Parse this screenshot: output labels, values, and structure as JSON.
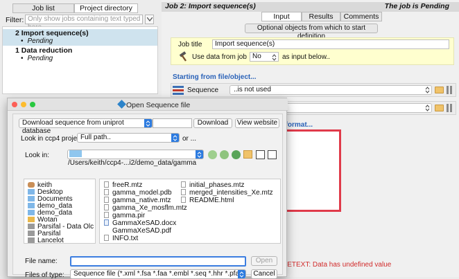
{
  "left": {
    "tabs": [
      "Job list",
      "Project directory"
    ],
    "filter_label": "Filter:",
    "filter_placeholder": "Only show jobs containing text typed here",
    "jobs": [
      {
        "title": "2 Import sequence(s)",
        "status": "Pending"
      },
      {
        "title": "1 Data reduction",
        "status": "Pending"
      }
    ]
  },
  "right": {
    "header_left": "Job 2:  Import sequence(s)",
    "header_right": "The job is Pending",
    "tabs": [
      "Input",
      "Results",
      "Comments"
    ],
    "optional_button": "Optional objects from which to start definition",
    "job_title_label": "Job title",
    "job_title_value": "Import sequence(s)",
    "use_data_label": "Use data from job",
    "use_data_value": "No",
    "as_input_label": "as input below..",
    "section_title": "Starting from file/object...",
    "sequence_label": "Sequence",
    "sequence_value": "..is not used",
    "format_title": "l format...",
    "error_text": "CETEXT: Data has undefined value"
  },
  "dialog": {
    "title": "Open Sequence file",
    "download_select": "Download sequence from uniprot database",
    "download_button": "Download",
    "website_button": "View website",
    "look_project_label": "Look in ccp4 project:",
    "look_project_value": "Full path..",
    "or_label": "or ...",
    "look_in_label": "Look in:",
    "look_in_path": "/Users/keith/ccp4-...i2/demo_data/gamma",
    "places": [
      "keith",
      "Desktop",
      "Documents",
      "demo_data",
      "demo_data",
      "Wotan",
      "Parsifal - Data Olc",
      "Parsifal",
      "Lancelot"
    ],
    "files_col1": [
      "freeR.mtz",
      "gamma_model.pdb",
      "gamma_native.mtz",
      "gamma_Xe_mosflm.mtz",
      "gamma.pir",
      "GammaXeSAD.docx",
      "GammaXeSAD.pdf",
      "INFO.txt"
    ],
    "files_col2": [
      "initial_phases.mtz",
      "merged_intensities_Xe.mtz",
      "README.html"
    ],
    "file_name_label": "File name:",
    "file_name_value": "",
    "open_button": "Open",
    "files_type_label": "Files of type:",
    "files_type_value": "Sequence file (*.xml *.fsa *.faa *.embl *.seq *.hhr *.pfam *.sth *.f",
    "cancel_button": "Cancel"
  }
}
